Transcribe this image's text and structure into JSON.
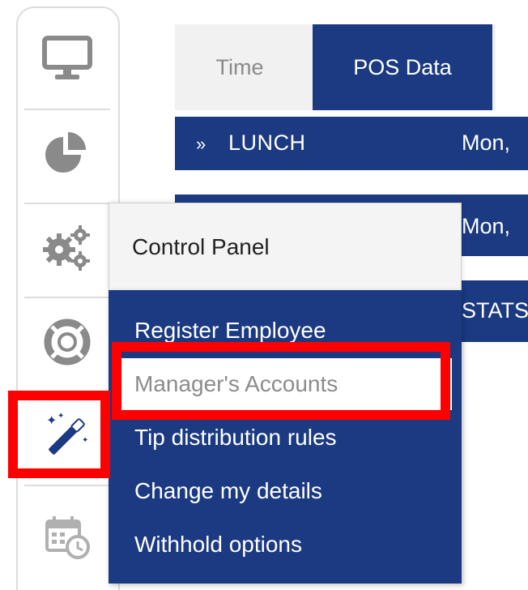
{
  "sidebar": {
    "items": [
      {
        "icon": "monitor-icon"
      },
      {
        "icon": "pie-chart-icon"
      },
      {
        "icon": "gears-icon"
      },
      {
        "icon": "lifebuoy-icon"
      },
      {
        "icon": "magic-wand-icon"
      },
      {
        "icon": "calendar-clock-icon"
      }
    ]
  },
  "tabs": [
    {
      "label": "Time"
    },
    {
      "label": "POS Data"
    }
  ],
  "rows": [
    {
      "chevron": "»",
      "name": "LUNCH",
      "date": "Mon,"
    },
    {
      "date": "Mon,"
    },
    {
      "stats": "STATS"
    }
  ],
  "menu": {
    "header": "Control Panel",
    "items": [
      {
        "label": "Register Employee"
      },
      {
        "label": "Manager's Accounts"
      },
      {
        "label": "Tip distribution rules"
      },
      {
        "label": "Change my details"
      },
      {
        "label": "Withhold options"
      }
    ]
  },
  "colors": {
    "navy": "#1b3a82",
    "highlight": "#ff0000",
    "icon_gray": "#8a8a8a"
  }
}
